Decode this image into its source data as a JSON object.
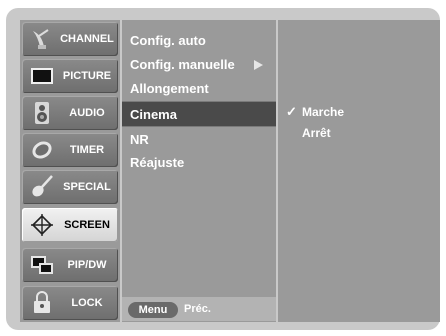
{
  "sidebar": {
    "items": [
      {
        "label": "CHANNEL",
        "icon": "satellite-dish-icon"
      },
      {
        "label": "PICTURE",
        "icon": "tv-screen-icon"
      },
      {
        "label": "AUDIO",
        "icon": "speaker-icon"
      },
      {
        "label": "TIMER",
        "icon": "clock-icon"
      },
      {
        "label": "SPECIAL",
        "icon": "guitar-icon"
      },
      {
        "label": "SCREEN",
        "icon": "screen-adjust-icon"
      },
      {
        "label": "PIP/DW",
        "icon": "pip-icon"
      },
      {
        "label": "LOCK",
        "icon": "lock-icon"
      }
    ],
    "active": "SCREEN"
  },
  "menu": {
    "items": [
      {
        "label": "Config. auto"
      },
      {
        "label": "Config. manuelle"
      },
      {
        "label": "Allongement"
      },
      {
        "label": "Cinema"
      },
      {
        "label": "NR"
      },
      {
        "label": "Réajuste"
      }
    ],
    "selected": "Cinema"
  },
  "options": {
    "items": [
      {
        "label": "Marche"
      },
      {
        "label": "Arrêt"
      }
    ],
    "check_mark": "✓",
    "selected": "Marche"
  },
  "footer": {
    "menu_label": "Menu",
    "back_label": "Préc."
  }
}
